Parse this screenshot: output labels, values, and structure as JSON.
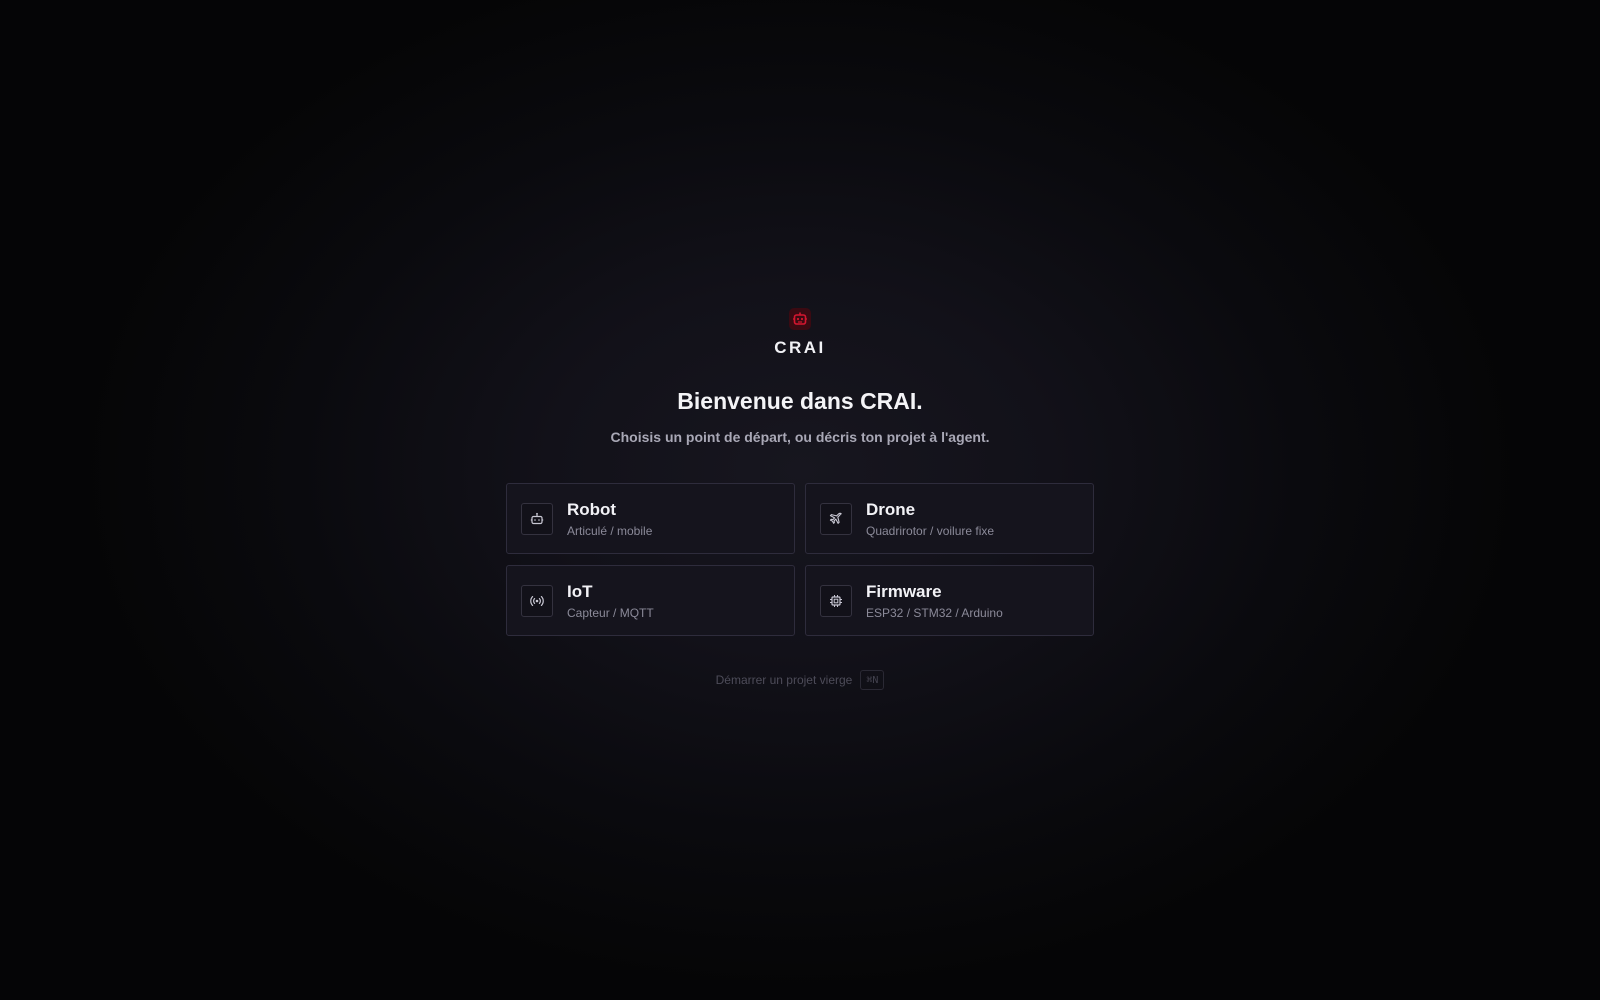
{
  "brand": {
    "name": "CRAI",
    "logo_icon": "robot-head-icon",
    "accent_color": "#c4142c"
  },
  "welcome": {
    "title": "Bienvenue dans CRAI.",
    "subtitle": "Choisis un point de départ, ou décris ton projet à l'agent."
  },
  "templates": [
    {
      "title": "Robot",
      "subtitle": "Articulé / mobile",
      "icon": "robot-icon"
    },
    {
      "title": "Drone",
      "subtitle": "Quadrirotor / voilure fixe",
      "icon": "plane-icon"
    },
    {
      "title": "IoT",
      "subtitle": "Capteur / MQTT",
      "icon": "radio-signal-icon"
    },
    {
      "title": "Firmware",
      "subtitle": "ESP32 / STM32 / Arduino",
      "icon": "chip-icon"
    }
  ],
  "blank_project": {
    "label": "Démarrer un projet vierge",
    "shortcut": "⌘N"
  }
}
